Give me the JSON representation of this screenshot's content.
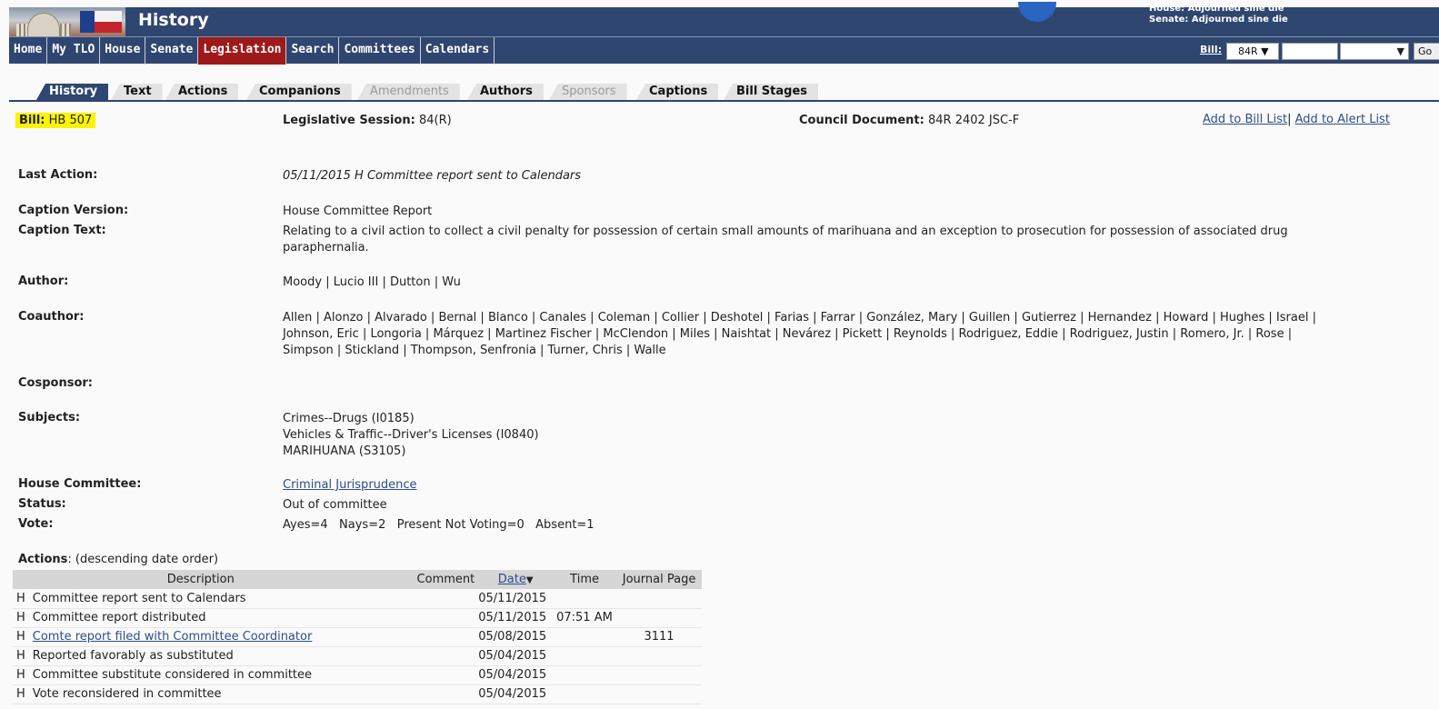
{
  "header": {
    "page_title": "History",
    "house_status": "House: Adjourned sine die",
    "senate_status": "Senate: Adjourned sine die"
  },
  "nav": {
    "items": [
      {
        "label": "Home"
      },
      {
        "label": "My TLO"
      },
      {
        "label": "House"
      },
      {
        "label": "Senate"
      },
      {
        "label": "Legislation",
        "active": true
      },
      {
        "label": "Search"
      },
      {
        "label": "Committees"
      },
      {
        "label": "Calendars"
      }
    ],
    "bill_label": "Bill:",
    "session_value": "84R ▼",
    "bill_number_value": "",
    "bill_type_value": "▼",
    "go_label": "Go"
  },
  "tabs": [
    {
      "label": "History",
      "active": true
    },
    {
      "label": "Text"
    },
    {
      "label": "Actions"
    },
    {
      "label": "Companions"
    },
    {
      "label": "Amendments",
      "disabled": true
    },
    {
      "label": "Authors"
    },
    {
      "label": "Sponsors",
      "disabled": true
    },
    {
      "label": "Captions"
    },
    {
      "label": "Bill Stages"
    }
  ],
  "bill": {
    "bill_label": "Bill:",
    "bill_number": "HB 507",
    "session_label": "Legislative Session:",
    "session_value": "84(R)",
    "council_label": "Council Document:",
    "council_value": "84R 2402 JSC-F",
    "add_bill_list": "Add to Bill List",
    "separator": "|",
    "add_alert_list": "Add to Alert List"
  },
  "fields": {
    "last_action_label": "Last Action:",
    "last_action_value": "05/11/2015 H Committee report sent to Calendars",
    "caption_version_label": "Caption Version:",
    "caption_version_value": "House Committee Report",
    "caption_text_label": "Caption Text:",
    "caption_text_line1": "Relating to a civil action to collect a civil penalty for possession of certain small amounts of marihuana and an exception to prosecution for possession of associated drug",
    "caption_text_line2": "paraphernalia.",
    "author_label": "Author:",
    "author_value": "Moody | Lucio III | Dutton | Wu",
    "coauthor_label": "Coauthor:",
    "coauthor_line1": "Allen | Alonzo | Alvarado | Bernal | Blanco | Canales | Coleman | Collier | Deshotel | Farias | Farrar | González, Mary | Guillen | Gutierrez | Hernandez | Howard | Hughes | Israel |",
    "coauthor_line2": "Johnson, Eric | Longoria | Márquez | Martinez Fischer | McClendon | Miles | Naishtat | Nevárez | Pickett | Reynolds | Rodriguez, Eddie | Rodriguez, Justin | Romero, Jr. | Rose |",
    "coauthor_line3": "Simpson | Stickland | Thompson, Senfronia | Turner, Chris | Walle",
    "cosponsor_label": "Cosponsor:",
    "subjects_label": "Subjects:",
    "subjects": [
      "Crimes--Drugs (I0185)",
      "Vehicles & Traffic--Driver's Licenses (I0840)",
      "MARIHUANA (S3105)"
    ],
    "house_committee_label": "House Committee:",
    "house_committee_value": "Criminal Jurisprudence",
    "status_label": "Status:",
    "status_value": "Out of committee",
    "vote_label": "Vote:",
    "vote_value": "Ayes=4   Nays=2   Present Not Voting=0   Absent=1"
  },
  "actions": {
    "title_bold": "Actions",
    "title_rest": ": (descending date order)",
    "columns": {
      "description": "Description",
      "comment": "Comment",
      "date": "Date",
      "sort_arrow": "▼",
      "time": "Time",
      "journal_page": "Journal Page"
    },
    "rows": [
      {
        "chamber": "H",
        "description": "Committee report sent to Calendars",
        "comment": "",
        "date": "05/11/2015",
        "time": "",
        "journal": "",
        "link": false
      },
      {
        "chamber": "H",
        "description": "Committee report distributed",
        "comment": "",
        "date": "05/11/2015",
        "time": "07:51 AM",
        "journal": "",
        "link": false
      },
      {
        "chamber": "H",
        "description": "Comte report filed with Committee Coordinator",
        "comment": "",
        "date": "05/08/2015",
        "time": "",
        "journal": "3111",
        "link": true
      },
      {
        "chamber": "H",
        "description": "Reported favorably as substituted",
        "comment": "",
        "date": "05/04/2015",
        "time": "",
        "journal": "",
        "link": false
      },
      {
        "chamber": "H",
        "description": "Committee substitute considered in committee",
        "comment": "",
        "date": "05/04/2015",
        "time": "",
        "journal": "",
        "link": false
      },
      {
        "chamber": "H",
        "description": "Vote reconsidered in committee",
        "comment": "",
        "date": "05/04/2015",
        "time": "",
        "journal": "",
        "link": false
      }
    ]
  }
}
